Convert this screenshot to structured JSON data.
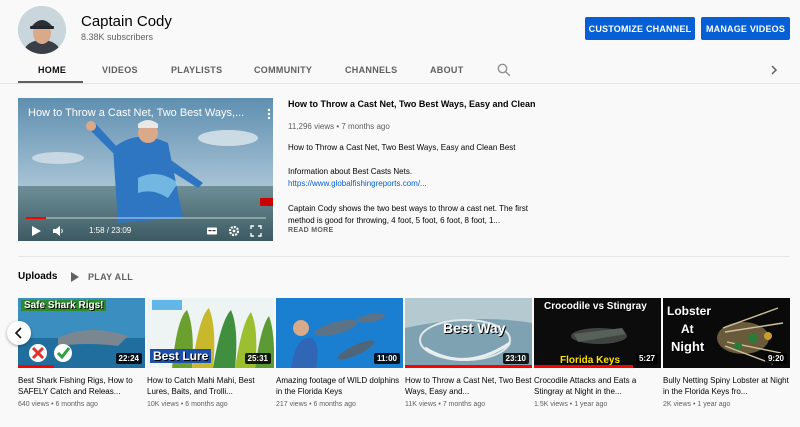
{
  "channel": {
    "name": "Captain Cody",
    "subscribers": "8.38K subscribers",
    "customize_label": "CUSTOMIZE CHANNEL",
    "manage_label": "MANAGE VIDEOS"
  },
  "tabs": [
    {
      "label": "HOME",
      "active": true
    },
    {
      "label": "VIDEOS"
    },
    {
      "label": "PLAYLISTS"
    },
    {
      "label": "COMMUNITY"
    },
    {
      "label": "CHANNELS"
    },
    {
      "label": "ABOUT"
    }
  ],
  "icons": {
    "search": "search-icon",
    "next": "chevron-right-icon",
    "prev": "chevron-left-icon",
    "play": "play-icon",
    "volume": "volume-icon",
    "captions": "captions-icon",
    "settings": "gear-icon",
    "fullscreen": "fullscreen-icon",
    "menu": "more-vertical-icon"
  },
  "colors": {
    "accent": "#065fd4",
    "progress": "#ff0000"
  },
  "featured": {
    "player_title": "How to Throw a Cast Net, Two Best Ways,...",
    "time": "1:58 / 23:09",
    "progress": 0.085,
    "title": "How to Throw a Cast Net, Two Best Ways, Easy and Clean",
    "meta": "11,296 views • 7 months ago",
    "desc_line1": "How to Throw a Cast Net, Two Best Ways, Easy and Clean Best",
    "desc_line2": "Information about Best Casts Nets.",
    "link": "https://www.globalfishingreports.com/...",
    "desc_line3": "Captain Cody shows the two best ways to throw a cast net. The first method is good for throwing, 4 foot, 5 foot, 6 foot, 8 foot, 1...",
    "read_more": "READ MORE"
  },
  "uploads": {
    "title": "Uploads",
    "play_all": "PLAY ALL",
    "videos": [
      {
        "thumb_text": "Safe Shark Rigs!",
        "duration": "22:24",
        "watched": 0.28,
        "title": "Best Shark Fishing Rigs, How to SAFELY Catch and Releas...",
        "meta": "640 views • 6 months ago"
      },
      {
        "thumb_text": "Best Lure",
        "duration": "25:31",
        "watched": 0.0,
        "title": "How to Catch Mahi Mahi, Best Lures, Baits, and Trolli...",
        "meta": "10K views • 6 months ago"
      },
      {
        "thumb_text": "",
        "duration": "11:00",
        "watched": 0.0,
        "title": "Amazing footage of WILD dolphins in the Florida Keys",
        "meta": "217 views • 6 months ago"
      },
      {
        "thumb_text": "Best Way",
        "duration": "23:10",
        "watched": 1.0,
        "title": "How to Throw a Cast Net, Two Best Ways, Easy and...",
        "meta": "11K views • 7 months ago"
      },
      {
        "thumb_text": "Crocodile vs Stingray",
        "thumb_text2": "Florida Keys",
        "duration": "5:27",
        "watched": 0.78,
        "title": "Crocodile Attacks and Eats a Stingray at Night in the...",
        "meta": "1.5K views • 1 year ago"
      },
      {
        "thumb_text": "Lobster",
        "thumb_text2": "At",
        "thumb_text3": "Night",
        "duration": "9:20",
        "watched": 0.0,
        "title": "Bully Netting Spiny Lobster at Night in the Florida Keys fro...",
        "meta": "2K views • 1 year ago"
      }
    ]
  }
}
